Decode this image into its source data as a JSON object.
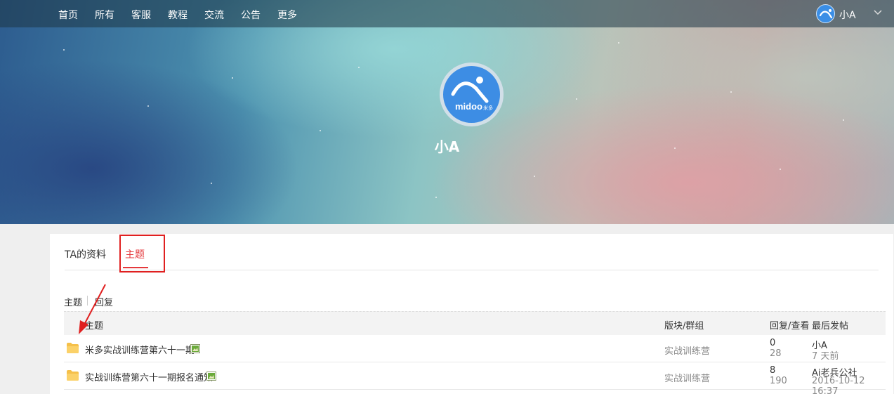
{
  "nav": {
    "items": [
      "首页",
      "所有",
      "客服",
      "教程",
      "交流",
      "公告",
      "更多"
    ],
    "user_name": "小A"
  },
  "profile": {
    "name": "小A",
    "avatar_brand": "midoo",
    "avatar_brand_cn": "米多"
  },
  "tabs": {
    "profile_label": "TA的资料",
    "topics_label": "主题"
  },
  "subtabs": {
    "topics_label": "主题",
    "replies_label": "回复"
  },
  "table": {
    "headers": {
      "topic": "主题",
      "forum": "版块/群组",
      "reply_view": "回复/查看",
      "last_post": "最后发帖"
    },
    "rows": [
      {
        "title": "米多实战训练营第六十一期",
        "forum": "实战训练营",
        "replies": "0",
        "views": "28",
        "last_author": "小A",
        "last_time": "7 天前"
      },
      {
        "title": "实战训练营第六十一期报名通知",
        "forum": "实战训练营",
        "replies": "8",
        "views": "190",
        "last_author": "Ai老兵公社",
        "last_time": "2016-10-12 16:37"
      }
    ]
  },
  "colors": {
    "accent": "#e4393c",
    "avatar_blue": "#3d8de4",
    "folder": "#f5c04a"
  }
}
